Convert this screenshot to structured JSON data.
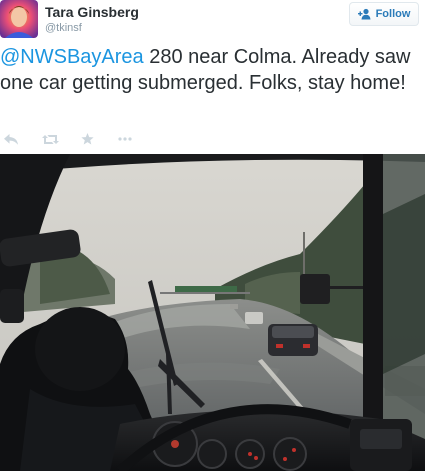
{
  "author": {
    "name": "Tara Ginsberg",
    "handle": "@tkinsf",
    "avatar_icon": "profile-photo"
  },
  "follow": {
    "label": "Follow",
    "icon": "add-user-icon",
    "color": "#2b7bb9"
  },
  "tweet": {
    "mention": "@NWSBayArea",
    "text": " 280 near Colma. Already saw one car getting submerged. Folks, stay home!"
  },
  "actions": [
    {
      "name": "reply",
      "icon": "reply-icon"
    },
    {
      "name": "retweet",
      "icon": "retweet-icon"
    },
    {
      "name": "favorite",
      "icon": "star-icon"
    },
    {
      "name": "more",
      "icon": "more-icon"
    }
  ],
  "media": {
    "description_icon": "flooded-highway-photo"
  },
  "colors": {
    "link": "#1b95e0",
    "text": "#292f33",
    "muted": "#8899a6",
    "icon_gray": "#ccd6dd"
  }
}
